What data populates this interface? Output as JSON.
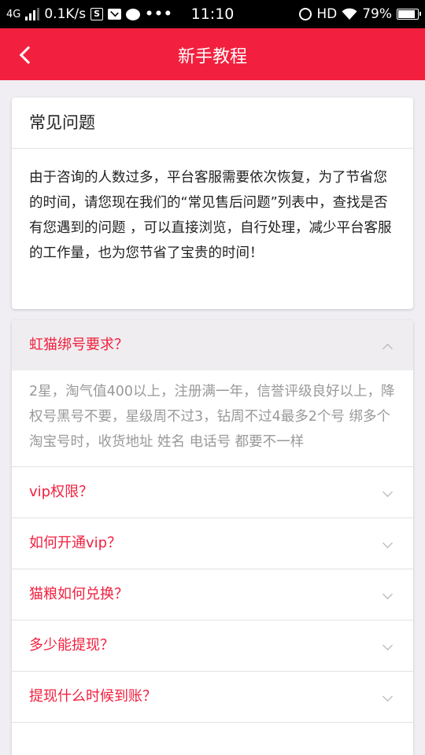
{
  "status_bar": {
    "network": "4G",
    "speed": "0.1K/s",
    "time": "11:10",
    "hd": "HD",
    "battery": "79%",
    "battery_level": 0.79
  },
  "header": {
    "back_icon": "chevron-left-icon",
    "title": "新手教程"
  },
  "intro": {
    "title": "常见问题",
    "body": "由于咨询的人数过多，平台客服需要依次恢复，为了节省您的时间，请您现在我们的“常见售后问题”列表中，查找是否有您遇到的问题 ，可以直接浏览，自行处理，减少平台客服的工作量，也为您节省了宝贵的时间！"
  },
  "faq": {
    "items": [
      {
        "question": "虹猫绑号要求？",
        "expanded": true,
        "answer": "2星，淘气值400以上，注册满一年，信誉评级良好以上，降权号黑号不要，星级周不过3，钻周不过4最多2个号 绑多个淘宝号时，收货地址 姓名 电话号 都要不一样"
      },
      {
        "question": "vip权限？",
        "expanded": false
      },
      {
        "question": "如何开通vip？",
        "expanded": false
      },
      {
        "question": "猫粮如何兑换？",
        "expanded": false
      },
      {
        "question": "多少能提现？",
        "expanded": false
      },
      {
        "question": "提现什么时候到账？",
        "expanded": false
      }
    ]
  },
  "colors": {
    "accent": "#f2203e",
    "answer_text": "#999999",
    "background": "#f0eef2"
  }
}
